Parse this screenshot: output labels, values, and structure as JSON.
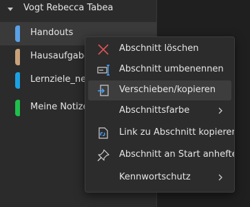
{
  "notebook": {
    "title": "Vogt Rebecca Tabea"
  },
  "sections": [
    {
      "label": "Handouts",
      "color": "#5aa0e6",
      "selected": true
    },
    {
      "label": "Hausaufgaben",
      "color": "#c9a27a",
      "selected": false
    },
    {
      "label": "Lernziele_neu",
      "color": "#1ba1e2",
      "selected": false
    },
    {
      "label": "Meine Notizen",
      "color": "#1fbf4b",
      "selected": false
    }
  ],
  "context_menu": {
    "items": [
      {
        "label": "Abschnitt löschen",
        "icon": "delete-x-icon",
        "submenu": false,
        "hover": false
      },
      {
        "label": "Abschnitt umbenennen",
        "icon": "rename-icon",
        "submenu": false,
        "hover": false
      },
      {
        "label": "Verschieben/kopieren",
        "icon": "move-copy-icon",
        "submenu": false,
        "hover": true
      },
      {
        "label": "Abschnittsfarbe",
        "icon": "",
        "submenu": true,
        "hover": false
      },
      {
        "label": "Link zu Abschnitt kopieren",
        "icon": "link-page-icon",
        "submenu": false,
        "hover": false
      },
      {
        "label": "Abschnitt an Start anheften",
        "icon": "pin-icon",
        "submenu": false,
        "hover": false
      },
      {
        "label": "Kennwortschutz",
        "icon": "",
        "submenu": true,
        "hover": false
      }
    ]
  },
  "colors": {
    "delete_icon": "#e05555",
    "accent_blue": "#4aa3ff"
  }
}
